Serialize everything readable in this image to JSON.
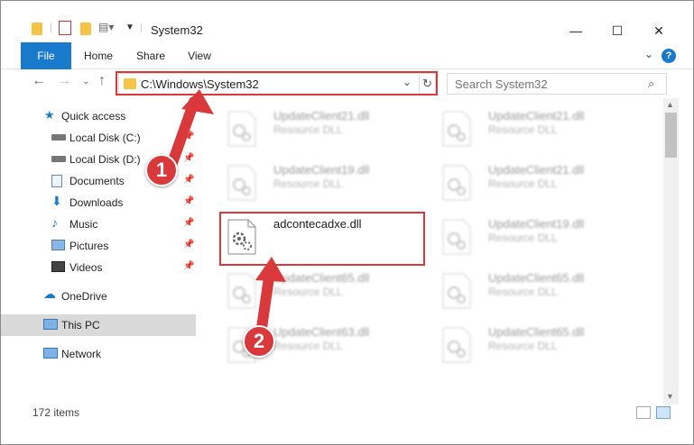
{
  "window": {
    "title": "System32",
    "minimize": "—",
    "maximize": "☐",
    "close": "✕"
  },
  "ribbon": {
    "tabs": [
      {
        "label": "File"
      },
      {
        "label": "Home"
      },
      {
        "label": "Share"
      },
      {
        "label": "View"
      }
    ],
    "help": "?"
  },
  "nav": {
    "address": "C:\\Windows\\System32",
    "search_placeholder": "Search System32"
  },
  "sidebar": {
    "items": [
      {
        "label": "Quick access",
        "icon": "star-icon"
      },
      {
        "label": "Local Disk (C:)",
        "icon": "drive-icon",
        "pinned": true
      },
      {
        "label": "Local Disk (D:)",
        "icon": "drive-icon",
        "pinned": true
      },
      {
        "label": "Documents",
        "icon": "documents-icon",
        "pinned": true
      },
      {
        "label": "Downloads",
        "icon": "downloads-icon",
        "pinned": true
      },
      {
        "label": "Music",
        "icon": "music-icon",
        "pinned": true
      },
      {
        "label": "Pictures",
        "icon": "pictures-icon",
        "pinned": true
      },
      {
        "label": "Videos",
        "icon": "videos-icon",
        "pinned": true
      },
      {
        "label": "OneDrive",
        "icon": "cloud-icon"
      },
      {
        "label": "This PC",
        "icon": "computer-icon",
        "selected": true
      },
      {
        "label": "Network",
        "icon": "network-icon"
      }
    ]
  },
  "files": [
    {
      "name": "UpdateClient21.dll",
      "type": "Resource DLL"
    },
    {
      "name": "UpdateClient21.dll",
      "type": "Resource DLL"
    },
    {
      "name": "UpdateClient19.dll",
      "type": "Resource DLL"
    },
    {
      "name": "UpdateClient21.dll",
      "type": "Resource DLL"
    },
    {
      "name": "adcontecadxe.dll",
      "type": ""
    },
    {
      "name": "UpdateClient19.dll",
      "type": "Resource DLL"
    },
    {
      "name": "UpdateClient65.dll",
      "type": "Resource DLL"
    },
    {
      "name": "UpdateClient65.dll",
      "type": "Resource DLL"
    },
    {
      "name": "UpdateClient63.dll",
      "type": "Resource DLL"
    },
    {
      "name": "UpdateClient65.dll",
      "type": "Resource DLL"
    }
  ],
  "status": {
    "count": "172 items"
  },
  "annotations": {
    "step1": "1",
    "step2": "2",
    "color": "#d9393b"
  }
}
